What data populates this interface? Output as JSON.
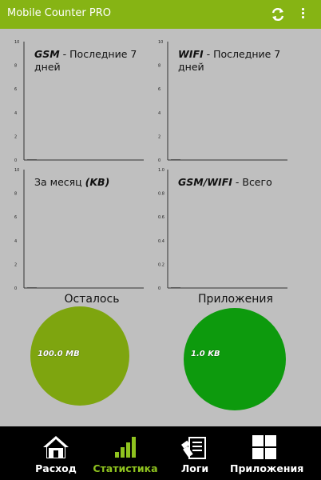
{
  "app": {
    "title": "Mobile Counter PRO",
    "refresh_icon": "refresh-icon",
    "overflow_icon": "overflow-menu-icon"
  },
  "colors": {
    "appbar": "#86b414",
    "background": "#bfbfbf",
    "pie_remaining": "#7ea50f",
    "pie_apps": "#0d9a0d",
    "nav_active": "#8fc31f"
  },
  "charts": {
    "gsm7": {
      "title_bold": "GSM",
      "title_rest": " - Последние 7 дней"
    },
    "wifi7": {
      "title_bold": "WIFI",
      "title_rest": " - Последние 7 дней"
    },
    "month": {
      "title_plain": "За месяц ",
      "title_italic": "(KB)"
    },
    "total": {
      "title_bold": "GSM/WIFI",
      "title_rest": " - Всего"
    }
  },
  "chart_data": [
    {
      "type": "bar",
      "title": "GSM - Последние 7 дней",
      "yticks": [
        "10",
        "8",
        "6",
        "4",
        "2",
        "0"
      ],
      "ylim": [
        0,
        10
      ],
      "values": [
        0
      ]
    },
    {
      "type": "bar",
      "title": "WIFI - Последние 7 дней",
      "yticks": [
        "10",
        "8",
        "6",
        "4",
        "2",
        "0"
      ],
      "ylim": [
        0,
        10
      ],
      "values": [
        0
      ]
    },
    {
      "type": "bar",
      "title": "За месяц (KB)",
      "yticks": [
        "10",
        "8",
        "6",
        "4",
        "2",
        "0"
      ],
      "ylim": [
        0,
        10
      ],
      "values": [
        0
      ]
    },
    {
      "type": "bar",
      "title": "GSM/WIFI - Всего",
      "yticks": [
        "1.0",
        "0.8",
        "0.6",
        "0.4",
        "0.2",
        "0"
      ],
      "ylim": [
        0,
        1
      ],
      "values": [
        0
      ]
    }
  ],
  "pies": {
    "remaining": {
      "label": "Осталось",
      "value": "100.0 MB"
    },
    "apps": {
      "label": "Приложения",
      "value": "1.0 KB"
    }
  },
  "nav": [
    {
      "label": "Расход",
      "icon": "home-icon",
      "active": false
    },
    {
      "label": "Статистика",
      "icon": "bar-chart-icon",
      "active": true
    },
    {
      "label": "Логи",
      "icon": "logs-icon",
      "active": false
    },
    {
      "label": "Приложения",
      "icon": "apps-grid-icon",
      "active": false
    }
  ]
}
